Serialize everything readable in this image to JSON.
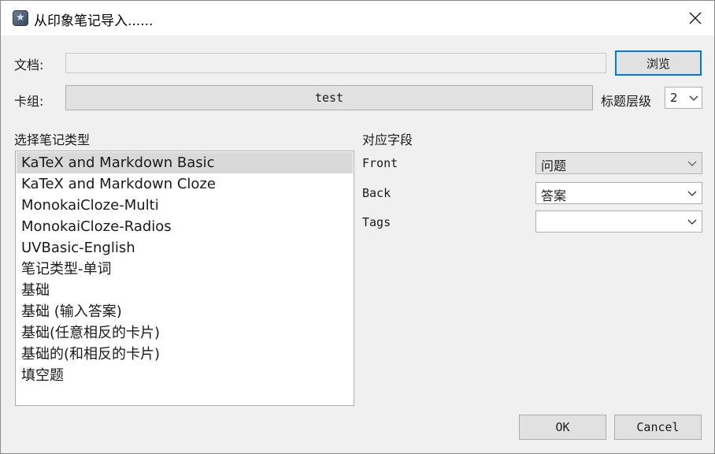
{
  "window": {
    "title": "从印象笔记导入......",
    "app_icon": "anki-star-icon",
    "close_icon": "close-icon"
  },
  "form": {
    "doc_label": "文档:",
    "doc_value": "",
    "browse_label": "浏览",
    "deck_label": "卡组:",
    "deck_value": "test",
    "heading_level_label": "标题层级",
    "heading_level_value": "2"
  },
  "notetypes": {
    "heading": "选择笔记类型",
    "selected_index": 0,
    "items": [
      "KaTeX and Markdown Basic",
      "KaTeX and Markdown Cloze",
      "MonokaiCloze-Multi",
      "MonokaiCloze-Radios",
      "UVBasic-English",
      "笔记类型-单词",
      "基础",
      "基础 (输入答案)",
      "基础(任意相反的卡片)",
      "基础的(和相反的卡片)",
      "填空题"
    ]
  },
  "mapping": {
    "heading": "对应字段",
    "fields": [
      {
        "name": "Front",
        "value": "问题"
      },
      {
        "name": "Back",
        "value": "答案"
      },
      {
        "name": "Tags",
        "value": ""
      }
    ]
  },
  "buttons": {
    "ok": "OK",
    "cancel": "Cancel"
  }
}
